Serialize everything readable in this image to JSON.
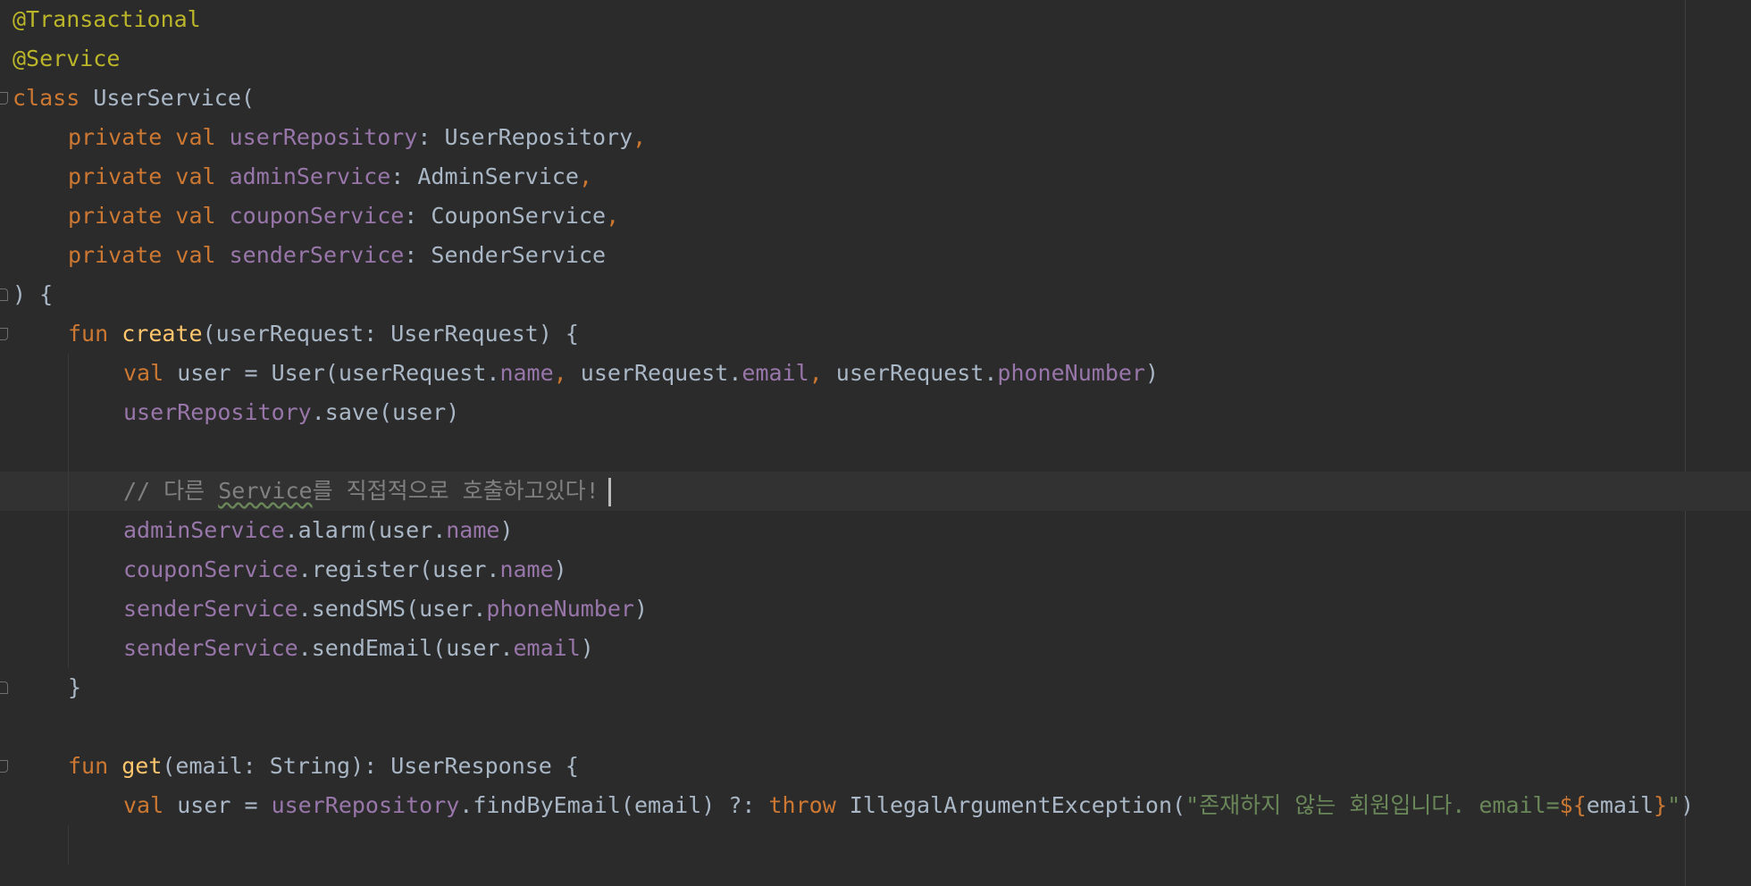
{
  "editor": {
    "language": "kotlin",
    "theme": "darcula",
    "lines": [
      {
        "indent": 0,
        "tokens": [
          {
            "t": "@Transactional",
            "c": "annotation"
          }
        ]
      },
      {
        "indent": 0,
        "tokens": [
          {
            "t": "@Service",
            "c": "annotation"
          }
        ]
      },
      {
        "indent": 0,
        "fold": "open",
        "tokens": [
          {
            "t": "class ",
            "c": "keyword"
          },
          {
            "t": "UserService(",
            "c": "plain"
          }
        ]
      },
      {
        "indent": 1,
        "tokens": [
          {
            "t": "private val ",
            "c": "keyword"
          },
          {
            "t": "userRepository",
            "c": "property"
          },
          {
            "t": ": UserRepository",
            "c": "plain"
          },
          {
            "t": ",",
            "c": "comma"
          }
        ]
      },
      {
        "indent": 1,
        "tokens": [
          {
            "t": "private val ",
            "c": "keyword"
          },
          {
            "t": "adminService",
            "c": "property"
          },
          {
            "t": ": AdminService",
            "c": "plain"
          },
          {
            "t": ",",
            "c": "comma"
          }
        ]
      },
      {
        "indent": 1,
        "tokens": [
          {
            "t": "private val ",
            "c": "keyword"
          },
          {
            "t": "couponService",
            "c": "property"
          },
          {
            "t": ": CouponService",
            "c": "plain"
          },
          {
            "t": ",",
            "c": "comma"
          }
        ]
      },
      {
        "indent": 1,
        "tokens": [
          {
            "t": "private val ",
            "c": "keyword"
          },
          {
            "t": "senderService",
            "c": "property"
          },
          {
            "t": ": SenderService",
            "c": "plain"
          }
        ]
      },
      {
        "indent": 0,
        "fold": "close",
        "tokens": [
          {
            "t": ") {",
            "c": "plain"
          }
        ]
      },
      {
        "indent": 1,
        "fold": "open",
        "tokens": [
          {
            "t": "fun ",
            "c": "keyword"
          },
          {
            "t": "create",
            "c": "function"
          },
          {
            "t": "(userRequest: UserRequest) {",
            "c": "plain"
          }
        ]
      },
      {
        "indent": 2,
        "tokens": [
          {
            "t": "val ",
            "c": "keyword"
          },
          {
            "t": "user = User(userRequest.",
            "c": "plain"
          },
          {
            "t": "name",
            "c": "property"
          },
          {
            "t": ", ",
            "c": "comma"
          },
          {
            "t": "userRequest.",
            "c": "plain"
          },
          {
            "t": "email",
            "c": "property"
          },
          {
            "t": ", ",
            "c": "comma"
          },
          {
            "t": "userRequest.",
            "c": "plain"
          },
          {
            "t": "phoneNumber",
            "c": "property"
          },
          {
            "t": ")",
            "c": "plain"
          }
        ]
      },
      {
        "indent": 2,
        "tokens": [
          {
            "t": "userRepository",
            "c": "property"
          },
          {
            "t": ".save(user)",
            "c": "plain"
          }
        ]
      },
      {
        "indent": 2,
        "tokens": []
      },
      {
        "indent": 2,
        "current": true,
        "caret": true,
        "tokens": [
          {
            "t": "// 다른 ",
            "c": "comment"
          },
          {
            "t": "Service",
            "c": "comment",
            "squiggle": true
          },
          {
            "t": "를 직접적으로 호출하고있다!",
            "c": "comment"
          }
        ]
      },
      {
        "indent": 2,
        "tokens": [
          {
            "t": "adminService",
            "c": "property"
          },
          {
            "t": ".alarm(user.",
            "c": "plain"
          },
          {
            "t": "name",
            "c": "property"
          },
          {
            "t": ")",
            "c": "plain"
          }
        ]
      },
      {
        "indent": 2,
        "tokens": [
          {
            "t": "couponService",
            "c": "property"
          },
          {
            "t": ".register(user.",
            "c": "plain"
          },
          {
            "t": "name",
            "c": "property"
          },
          {
            "t": ")",
            "c": "plain"
          }
        ]
      },
      {
        "indent": 2,
        "tokens": [
          {
            "t": "senderService",
            "c": "property"
          },
          {
            "t": ".sendSMS(user.",
            "c": "plain"
          },
          {
            "t": "phoneNumber",
            "c": "property"
          },
          {
            "t": ")",
            "c": "plain"
          }
        ]
      },
      {
        "indent": 2,
        "tokens": [
          {
            "t": "senderService",
            "c": "property"
          },
          {
            "t": ".sendEmail(user.",
            "c": "plain"
          },
          {
            "t": "email",
            "c": "property"
          },
          {
            "t": ")",
            "c": "plain"
          }
        ]
      },
      {
        "indent": 1,
        "fold": "close",
        "tokens": [
          {
            "t": "}",
            "c": "plain"
          }
        ]
      },
      {
        "indent": 1,
        "tokens": []
      },
      {
        "indent": 1,
        "fold": "open",
        "tokens": [
          {
            "t": "fun ",
            "c": "keyword"
          },
          {
            "t": "get",
            "c": "function"
          },
          {
            "t": "(email: String): UserResponse {",
            "c": "plain"
          }
        ]
      },
      {
        "indent": 2,
        "tokens": [
          {
            "t": "val ",
            "c": "keyword"
          },
          {
            "t": "user = ",
            "c": "plain"
          },
          {
            "t": "userRepository",
            "c": "property"
          },
          {
            "t": ".findByEmail(email) ?: ",
            "c": "plain"
          },
          {
            "t": "throw ",
            "c": "keyword"
          },
          {
            "t": "IllegalArgumentException(",
            "c": "plain"
          },
          {
            "t": "\"존재하지 않는 회원입니다. email=",
            "c": "string"
          },
          {
            "t": "${",
            "c": "interp"
          },
          {
            "t": "email",
            "c": "plain"
          },
          {
            "t": "}",
            "c": "interp"
          },
          {
            "t": "\"",
            "c": "string"
          },
          {
            "t": ")",
            "c": "plain"
          }
        ]
      },
      {
        "indent": 2,
        "tokens": []
      }
    ]
  }
}
